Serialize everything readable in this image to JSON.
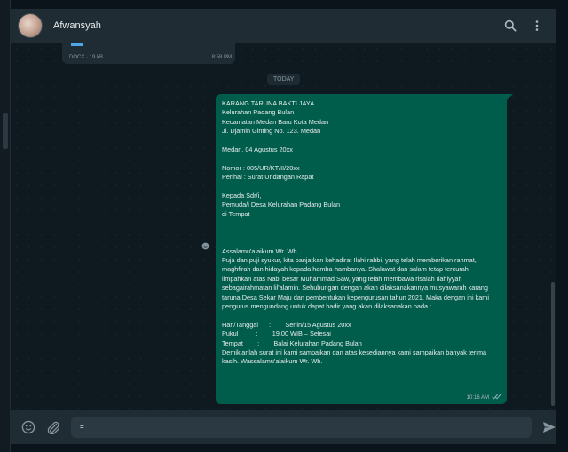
{
  "header": {
    "contact_name": "Afwansyah"
  },
  "previous_message": {
    "doc_type": "DOCX",
    "doc_size": "19 kB",
    "doc_label": "DOCX · 19 kB",
    "time": "8:58 PM"
  },
  "date_separator": "TODAY",
  "message": {
    "text": "KARANG TARUNA BAKTI JAYA\nKelurahan Padang Bulan\nKecamatan Medan Baru Kota Medan\nJl. Djamin Ginting No. 123. Medan\n\nMedan, 04 Agustus 20xx\n\nNomor : 005/UR/KT/II/20xx\nPerihal : Surat Undangan Rapat\n\nKepada Sdr/i,\nPemuda/i Desa Kelurahan Padang Bulan\ndi Tempat\n\n\n\nAssalamu'alaikum Wr. Wb.\nPuja dan puji syukur, kita panjatkan kehadirat Ilahi rabbi, yang telah memberikan rahmat, maghfirah dan hidayah kepada hamba-hambanya. Shalawat dan salam tetap tercurah limpahkan atas Nabi besar Muhammad Saw, yang telah membawa risalah Ilahiyyah sebagairahmatan lil'alamin. Sehubungan dengan akan dilaksanakannya musyawarah karang taruna Desa Sekar Maju dan pembentukan kepengurusan tahun 2021. Maka dengan ini kami pengurus mengundang untuk dapat hadir yang akan dilaksanakan pada :\n\nHari/Tanggal      :        Senin/15 Agustus 20xx\nPukul          :        19.00 WIB – Selesai\nTempat        :        Balai Kelurahan Padang Bulan\nDemikianlah surat ini kami sampaikan dan atas kesediannya kami sampaikan banyak terima kasih. Wassalamu'alaikum Wr. Wb.",
    "time": "10:16 AM",
    "status": "read"
  },
  "composer": {
    "value": "="
  },
  "icons": {
    "search": "search-icon",
    "menu": "more-vertical-icon",
    "emoji": "emoji-icon",
    "attach": "paperclip-icon",
    "send": "send-icon",
    "read": "double-check-icon",
    "react": "emoji-react-icon"
  },
  "colors": {
    "outgoing_bubble": "#005c4b",
    "header": "#202c33",
    "background": "#0b141a",
    "read_ticks": "#53bdeb"
  }
}
